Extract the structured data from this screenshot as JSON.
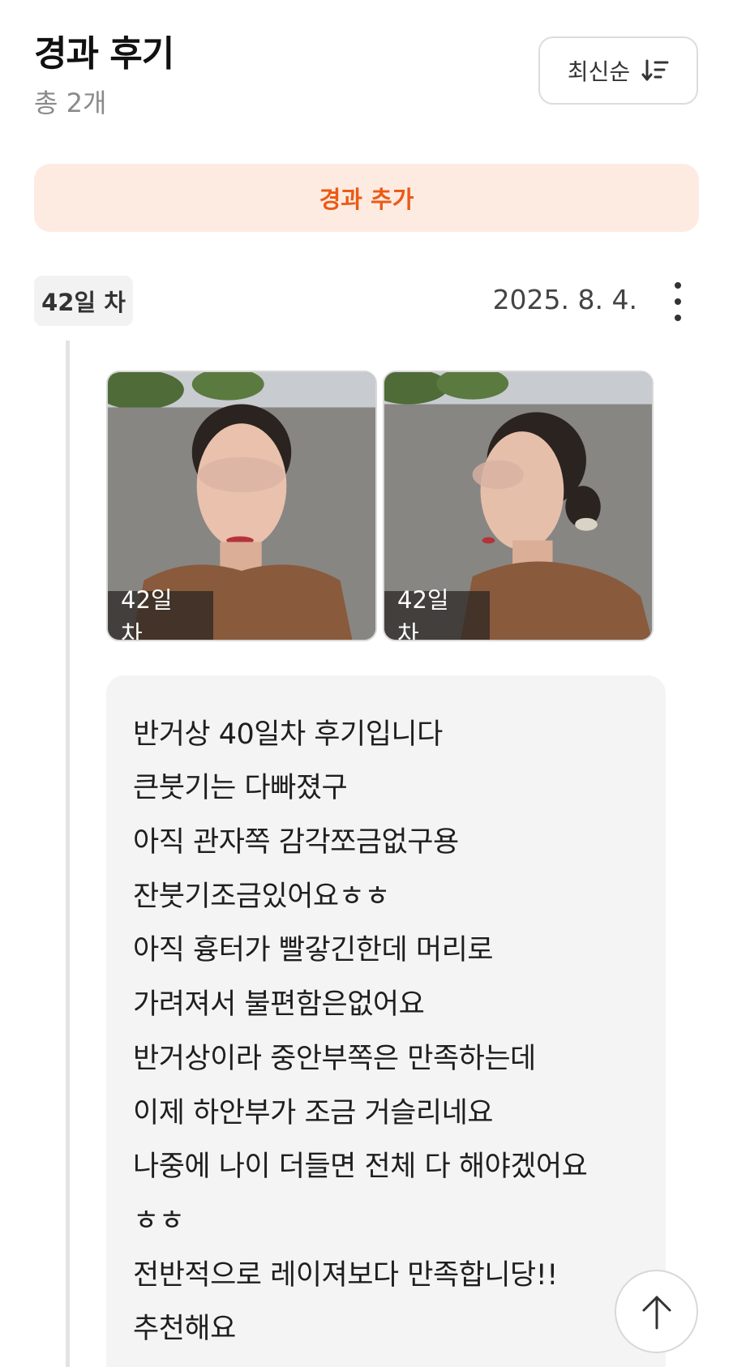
{
  "header": {
    "title": "경과 후기",
    "count": "총 2개",
    "sort_label": "최신순"
  },
  "add_button_label": "경과 추가",
  "entry": {
    "day_badge": "42일 차",
    "date": "2025. 8. 4.",
    "photos": [
      {
        "label": "42일 차"
      },
      {
        "label": "42일 차"
      }
    ],
    "review_lines": [
      "반거상 40일차 후기입니다",
      "큰붓기는 다빠졌구",
      "아직 관자쪽 감각쪼금없구용",
      "잔붓기조금있어요ㅎㅎ",
      "아직 흉터가 빨갛긴한데 머리로",
      "가려져서 불편함은없어요",
      "반거상이라 중안부쪽은 만족하는데",
      "이제 하안부가 조금 거슬리네요",
      "나중에 나이 더들면 전체 다 해야겠어요",
      "ㅎㅎ",
      "전반적으로 레이져보다 만족합니당!!",
      "추천해요"
    ]
  },
  "icons": {
    "sort": "sort-descending-icon",
    "more": "more-vertical-icon",
    "scroll_top": "arrow-up-icon"
  },
  "colors": {
    "accent": "#ec5a14",
    "accent_bg": "#fdebe2"
  }
}
